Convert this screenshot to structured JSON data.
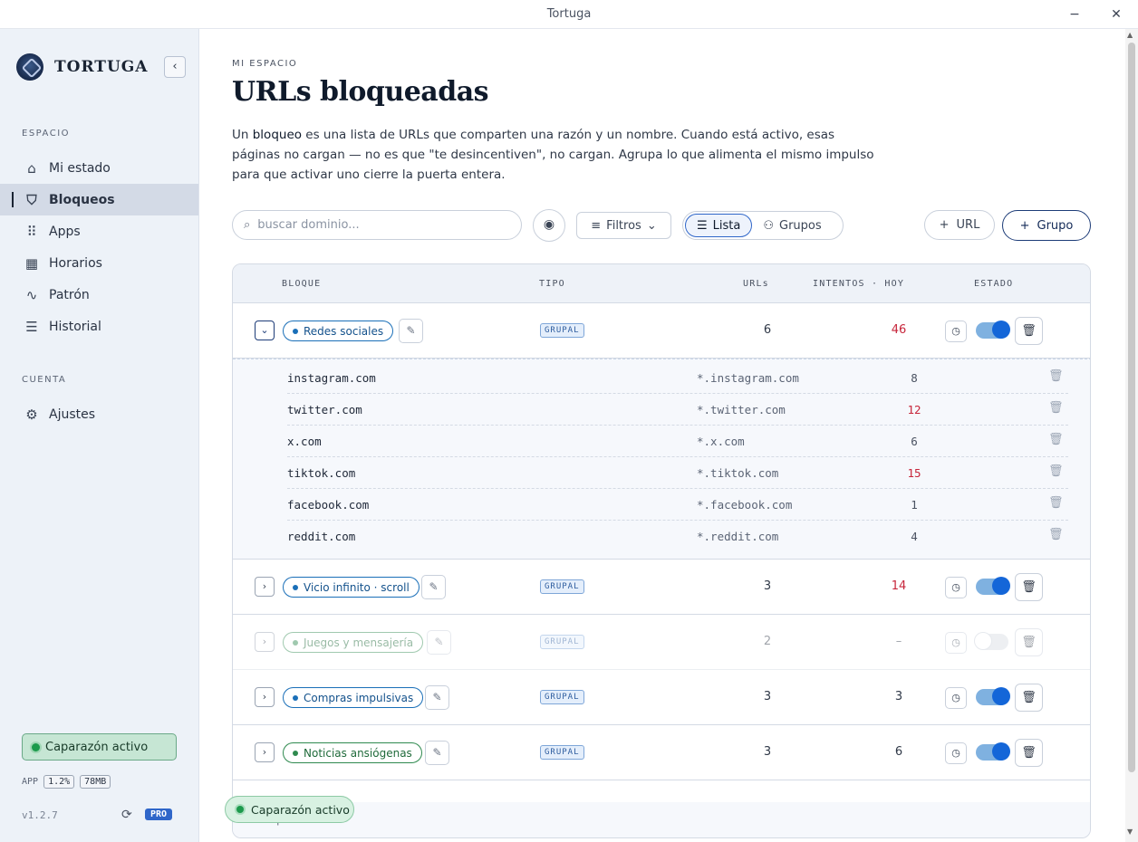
{
  "window": {
    "title": "Tortuga",
    "minimize": "−",
    "close": "✕"
  },
  "sidebar": {
    "brand": "TORTUGA",
    "collapse_icon": "‹",
    "section_space": "ESPACIO",
    "section_account": "CUENTA",
    "items": [
      {
        "label": "Mi estado",
        "icon": "⌂"
      },
      {
        "label": "Bloqueos",
        "icon": "⛉"
      },
      {
        "label": "Apps",
        "icon": "⠿"
      },
      {
        "label": "Horarios",
        "icon": "▦"
      },
      {
        "label": "Patrón",
        "icon": "∿"
      },
      {
        "label": "Historial",
        "icon": "☰"
      }
    ],
    "settings": {
      "label": "Ajustes",
      "icon": "⚙"
    },
    "shell_status": "Caparazón activo",
    "stats_label": "APP",
    "cpu": "1.2%",
    "mem": "78MB",
    "version": "v1.2.7",
    "pro": "PRO"
  },
  "header": {
    "eyebrow": "MI ESPACIO",
    "title": "URLs bloqueadas",
    "intro_a": "Un ",
    "intro_bold": "bloqueo",
    "intro_b": " es una lista de URLs que comparten una razón y un nombre. Cuando está activo, esas páginas no cargan — no es que \"te desincentiven\", no cargan. Agrupa lo que alimenta el mismo impulso para que activar uno cierre la puerta entera."
  },
  "toolbar": {
    "search_placeholder": "buscar dominio...",
    "filters": "Filtros",
    "view_list": "Lista",
    "view_groups": "Grupos",
    "add_url": "URL",
    "add_group": "Grupo"
  },
  "table": {
    "headers": {
      "block": "BLOQUE",
      "type": "TIPO",
      "urls": "URLs",
      "hits": "INTENTOS · HOY",
      "status": "ESTADO"
    },
    "rows": [
      {
        "name": "Redes sociales",
        "type": "GRUPAL",
        "urls": "6",
        "hits": "46",
        "enabled": true
      },
      {
        "name": "Vicio infinito · scroll",
        "type": "GRUPAL",
        "urls": "3",
        "hits": "14",
        "enabled": true
      },
      {
        "name": "Juegos y mensajería",
        "type": "GRUPAL",
        "urls": "2",
        "hits": "–",
        "enabled": false
      },
      {
        "name": "Compras impulsivas",
        "type": "GRUPAL",
        "urls": "3",
        "hits": "3",
        "enabled": true
      },
      {
        "name": "Noticias ansiógenas",
        "type": "GRUPAL",
        "urls": "3",
        "hits": "6",
        "enabled": true
      }
    ],
    "expanded_urls": [
      {
        "domain": "instagram.com",
        "pattern": "*.instagram.com",
        "hits": "8"
      },
      {
        "domain": "twitter.com",
        "pattern": "*.twitter.com",
        "hits": "12"
      },
      {
        "domain": "x.com",
        "pattern": "*.x.com",
        "hits": "6"
      },
      {
        "domain": "tiktok.com",
        "pattern": "*.tiktok.com",
        "hits": "15"
      },
      {
        "domain": "facebook.com",
        "pattern": "*.facebook.com",
        "hits": "1"
      },
      {
        "domain": "reddit.com",
        "pattern": "*.reddit.com",
        "hits": "4"
      }
    ],
    "footer": "5 bloqueos"
  },
  "floating_status": "Caparazón activo"
}
